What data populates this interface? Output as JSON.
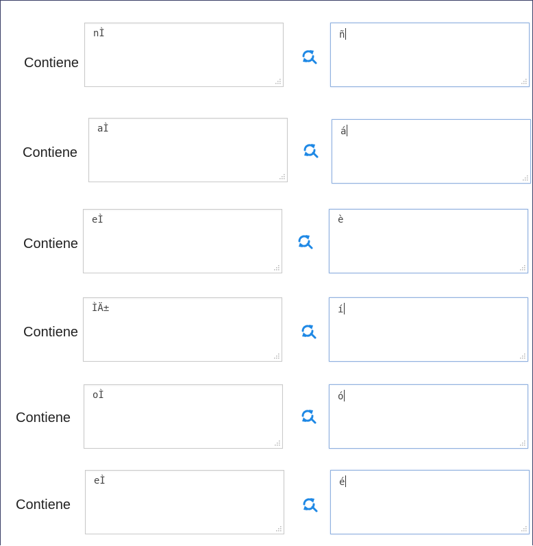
{
  "colors": {
    "accent": "#1e88e5",
    "frame": "#3a3f66"
  },
  "icons": {
    "replace": "refresh-search-icon",
    "resize": "resize-grip-icon"
  },
  "rows": [
    {
      "label": "Contiene",
      "find": "nÌ",
      "replace": "ñ"
    },
    {
      "label": "Contiene",
      "find": "aÌ",
      "replace": "á"
    },
    {
      "label": "Contiene",
      "find": "eÌ",
      "replace": "è"
    },
    {
      "label": "Contiene",
      "find": "ÌÄ±",
      "replace": "í"
    },
    {
      "label": "Contiene",
      "find": "oÌ",
      "replace": "ó"
    },
    {
      "label": "Contiene",
      "find": "eÌ",
      "replace": "é"
    }
  ]
}
